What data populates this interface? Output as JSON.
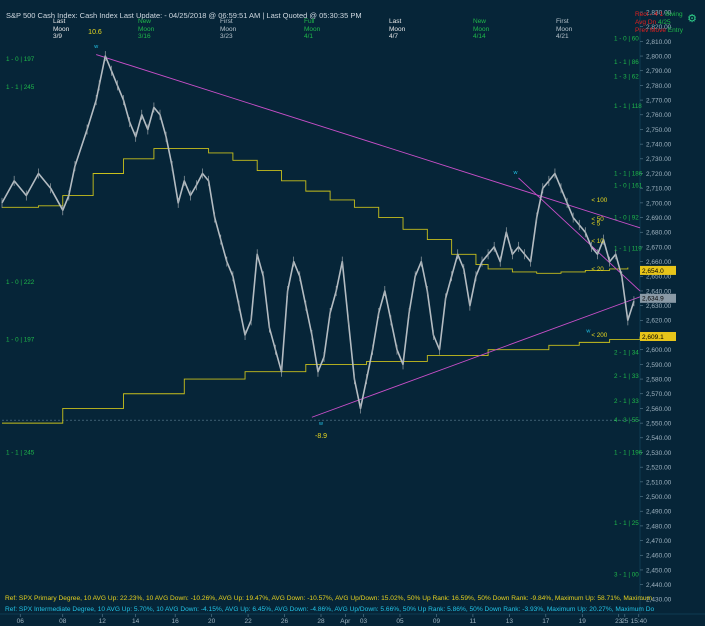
{
  "header": {
    "title": "S&P 500 Cash Index:   Cash Index   Last Update: - 04/25/2018 @ 06:59:51 AM | Last Quoted @ 05:30:35 PM",
    "moon_columns": [
      {
        "l1": "Last",
        "l2": "Moon",
        "l3": "3/9",
        "color": "#e8e8e8"
      },
      {
        "l1": "New",
        "l2": "Moon",
        "l3": "3/16",
        "color": "#1fb84a"
      },
      {
        "l1": "First",
        "l2": "Moon",
        "l3": "3/23",
        "color": "#b8c4cc"
      },
      {
        "l1": "Full",
        "l2": "Moon",
        "l3": "4/1",
        "color": "#1fb84a"
      },
      {
        "l1": "Last",
        "l2": "Moon",
        "l3": "4/7",
        "color": "#e8e8e8"
      },
      {
        "l1": "New",
        "l2": "Moon",
        "l3": "4/14",
        "color": "#1fb84a"
      },
      {
        "l1": "First",
        "l2": "Moon",
        "l3": "4/21",
        "color": "#b8c4cc"
      }
    ],
    "right_labels": [
      {
        "text": "Rect - 4 1",
        "color": "#e02020"
      },
      {
        "text": "Avg Dn",
        "color": "#e02020"
      },
      {
        "text": "Prev Move",
        "color": "#e02020"
      }
    ],
    "right_labels_b": [
      {
        "text": "Swing",
        "color": "#1fb84a"
      },
      {
        "text": "4/25",
        "color": "#1fb84a"
      },
      {
        "text": "Entry",
        "color": "#1fb84a"
      }
    ],
    "tool_icon": "settings-icon"
  },
  "footer": {
    "line1": "Ref: SPX Primary Degree, 10 AVG Up: 22.23%, 10 AVG Down: -10.26%, AVG Up: 19.47%, AVG Down: -10.57%, AVG Up/Down: 15.02%, 50%  Up Rank: 16.59%, 50% Down Rank: -9.84%, Maximum Up: 58.71%, Maximum",
    "line2": "Ref: SPX Intermediate Degree, 10 AVG Up: 5.70%, 10 AVG Down: -4.15%, AVG Up: 6.45%, AVG Down: -4.86%, AVG Up/Down: 5.66%, 50%  Up Rank: 5.86%, 50% Down Rank: -3.93%, Maximum Up: 20.27%, Maximum Do"
  },
  "chart_data": {
    "type": "line",
    "ylim": [
      2420,
      2830
    ],
    "yticks": [
      2430,
      2440,
      2450,
      2460,
      2470,
      2480,
      2490,
      2500,
      2510,
      2520,
      2530,
      2540,
      2550,
      2560,
      2570,
      2580,
      2590,
      2600,
      2610,
      2620,
      2630,
      2640,
      2650,
      2660,
      2670,
      2680,
      2690,
      2700,
      2710,
      2720,
      2730,
      2740,
      2750,
      2760,
      2770,
      2780,
      2790,
      2800,
      2810,
      2820,
      2830
    ],
    "ytick_labels": [
      "2,430.00",
      "2,440.00",
      "2,450.00",
      "2,460.00",
      "2,470.00",
      "2,480.00",
      "2,490.00",
      "2,500.00",
      "2,510.00",
      "2,520.00",
      "2,530.00",
      "2,540.00",
      "2,550.00",
      "2,560.00",
      "2,570.00",
      "2,580.00",
      "2,590.00",
      "2,600.00",
      "2,610.00",
      "2,620.00",
      "2,630.00",
      "2,640.00",
      "2,650.00",
      "2,660.00",
      "2,670.00",
      "2,680.00",
      "2,690.00",
      "2,700.00",
      "2,710.00",
      "2,720.00",
      "2,730.00",
      "2,740.00",
      "2,750.00",
      "2,760.00",
      "2,770.00",
      "2,780.00",
      "2,790.00",
      "2,800.00",
      "2,810.00",
      "2,820.00",
      "2,830.00"
    ],
    "xlim": [
      0,
      105
    ],
    "xticks": [
      {
        "x": 3,
        "label": "06"
      },
      {
        "x": 10,
        "label": "08"
      },
      {
        "x": 16.5,
        "label": "12"
      },
      {
        "x": 22,
        "label": "14"
      },
      {
        "x": 28.5,
        "label": "16"
      },
      {
        "x": 34.5,
        "label": "20"
      },
      {
        "x": 40.5,
        "label": "22"
      },
      {
        "x": 46.5,
        "label": "26"
      },
      {
        "x": 52.5,
        "label": "28"
      },
      {
        "x": 56.5,
        "label": "Apr"
      },
      {
        "x": 59.5,
        "label": "03"
      },
      {
        "x": 65.5,
        "label": "05"
      },
      {
        "x": 71.5,
        "label": "09"
      },
      {
        "x": 77.5,
        "label": "11"
      },
      {
        "x": 83.5,
        "label": "13"
      },
      {
        "x": 89.5,
        "label": "17"
      },
      {
        "x": 95.5,
        "label": "19"
      },
      {
        "x": 101.5,
        "label": "23"
      },
      {
        "x": 102.5,
        "label": "25"
      },
      {
        "x": 104.8,
        "label": "15:40"
      }
    ],
    "price_series": {
      "name": "SPX",
      "x": [
        0,
        2,
        4,
        6,
        8,
        10,
        11,
        12,
        14,
        15.5,
        16,
        17,
        18,
        19,
        20,
        21,
        22,
        23,
        24,
        25,
        26,
        27,
        28,
        29,
        30,
        31,
        32,
        33,
        34,
        35,
        36,
        37,
        38,
        39,
        40,
        41,
        42,
        43,
        44,
        45,
        46,
        47,
        48,
        49,
        50,
        51,
        52,
        53,
        54,
        55,
        56,
        57,
        58,
        59,
        60,
        61,
        62,
        63,
        64,
        65,
        66,
        67,
        68,
        69,
        70,
        71,
        72,
        73,
        74,
        75,
        76,
        77,
        78,
        79,
        80,
        81,
        82,
        83,
        84,
        85,
        86,
        87,
        88,
        89,
        90,
        91,
        92,
        93,
        94,
        95,
        96,
        97,
        98,
        99,
        100,
        101,
        102,
        103,
        104
      ],
      "y": [
        2700,
        2715,
        2705,
        2720,
        2710,
        2695,
        2705,
        2725,
        2750,
        2770,
        2780,
        2800,
        2790,
        2780,
        2770,
        2755,
        2745,
        2760,
        2750,
        2765,
        2760,
        2745,
        2725,
        2700,
        2715,
        2705,
        2712,
        2720,
        2715,
        2690,
        2675,
        2660,
        2650,
        2630,
        2610,
        2620,
        2665,
        2650,
        2615,
        2600,
        2585,
        2640,
        2660,
        2650,
        2630,
        2610,
        2585,
        2595,
        2625,
        2640,
        2660,
        2620,
        2580,
        2560,
        2580,
        2600,
        2625,
        2640,
        2620,
        2600,
        2590,
        2625,
        2650,
        2660,
        2640,
        2610,
        2600,
        2635,
        2650,
        2665,
        2655,
        2630,
        2650,
        2660,
        2665,
        2670,
        2660,
        2680,
        2665,
        2670,
        2665,
        2660,
        2690,
        2710,
        2715,
        2720,
        2710,
        2700,
        2690,
        2685,
        2680,
        2670,
        2665,
        2675,
        2660,
        2665,
        2650,
        2620,
        2633
      ]
    },
    "overlay_lines": [
      {
        "name": "upper-trendline",
        "color": "#c94fc9",
        "x": [
          15.5,
          105
        ],
        "y": [
          2801,
          2683
        ]
      },
      {
        "name": "lower-trendline",
        "color": "#c94fc9",
        "x": [
          51,
          105
        ],
        "y": [
          2554,
          2636
        ]
      },
      {
        "name": "short-downtrend",
        "color": "#c94fc9",
        "x": [
          85,
          105
        ],
        "y": [
          2717,
          2640
        ]
      }
    ],
    "step_lines": [
      {
        "name": "ma-200",
        "color": "#c8c01c",
        "x": [
          0,
          10,
          20,
          30,
          40,
          50,
          60,
          70,
          80,
          90,
          95,
          100,
          105
        ],
        "y": [
          2550,
          2560,
          2570,
          2580,
          2585,
          2590,
          2592,
          2596,
          2600,
          2603,
          2605,
          2607,
          2609
        ]
      },
      {
        "name": "ma-50",
        "color": "#c8c01c",
        "x": [
          0,
          6,
          10,
          15,
          20,
          25,
          30,
          34,
          38,
          42,
          46,
          50,
          54,
          58,
          62,
          66,
          70,
          74,
          78,
          80,
          84,
          88,
          92,
          96,
          100,
          103
        ],
        "y": [
          2697,
          2698,
          2705,
          2720,
          2730,
          2737,
          2737,
          2734,
          2729,
          2722,
          2715,
          2708,
          2702,
          2697,
          2690,
          2682,
          2675,
          2665,
          2658,
          2655,
          2653,
          2652,
          2653,
          2654,
          2655,
          2656
        ]
      }
    ],
    "annotations": {
      "peak_value": "10.6",
      "trough_value": "-8.9",
      "wave_marks": [
        {
          "text": "w",
          "x": 15.5,
          "y": 2807
        },
        {
          "text": "w",
          "x": 84.5,
          "y": 2721
        },
        {
          "text": "w",
          "x": 52.5,
          "y": 2550
        },
        {
          "text": "w",
          "x": 96.5,
          "y": 2613
        }
      ],
      "lt_labels": [
        {
          "text": "< 100",
          "x": 97,
          "y": 2702
        },
        {
          "text": "< 50",
          "x": 97,
          "y": 2689
        },
        {
          "text": "< 5",
          "x": 97,
          "y": 2686
        },
        {
          "text": "< 10",
          "x": 97,
          "y": 2674
        },
        {
          "text": "< 20",
          "x": 97,
          "y": 2655
        },
        {
          "text": "< 200",
          "x": 97,
          "y": 2610
        }
      ]
    },
    "fib_labels_left": [
      {
        "text": "1 - 0 | 197",
        "y": 2798
      },
      {
        "text": "1 - 1 | 245",
        "y": 2779
      },
      {
        "text": "1 - 0 | 222",
        "y": 2646
      },
      {
        "text": "1 - 0 | 197",
        "y": 2607
      },
      {
        "text": "1 - 1 | 245",
        "y": 2530
      }
    ],
    "fib_labels_right": [
      {
        "text": "1 - 0 | 60",
        "y": 2812
      },
      {
        "text": "1 - 1 | 86",
        "y": 2796
      },
      {
        "text": "1 - 3 | 62",
        "y": 2786
      },
      {
        "text": "1 - 1 | 118",
        "y": 2766
      },
      {
        "text": "1 - 1 | 186",
        "y": 2720
      },
      {
        "text": "1 - 0 | 161",
        "y": 2712
      },
      {
        "text": "1 - 0 | 92",
        "y": 2690
      },
      {
        "text": "1 - 1 | 119",
        "y": 2669
      },
      {
        "text": "2 - 1 | 34",
        "y": 2598
      },
      {
        "text": "2 - 1 | 33",
        "y": 2582
      },
      {
        "text": "2 - 1 | 33",
        "y": 2565
      },
      {
        "text": "4 - 3 | 55",
        "y": 2552
      },
      {
        "text": "1 - 1 | 196",
        "y": 2530
      },
      {
        "text": "1 - 1 | 25",
        "y": 2482
      },
      {
        "text": "3 - 1 | 00",
        "y": 2447
      }
    ],
    "price_boxes": [
      {
        "text": "2,654.0",
        "y": 2654,
        "color": "#e8c51a"
      },
      {
        "text": "2,634.9",
        "y": 2635,
        "color": "#8a9aa6"
      },
      {
        "text": "2,609.1",
        "y": 2609,
        "color": "#e8c51a"
      }
    ],
    "support_level": 2552,
    "grid": false
  }
}
